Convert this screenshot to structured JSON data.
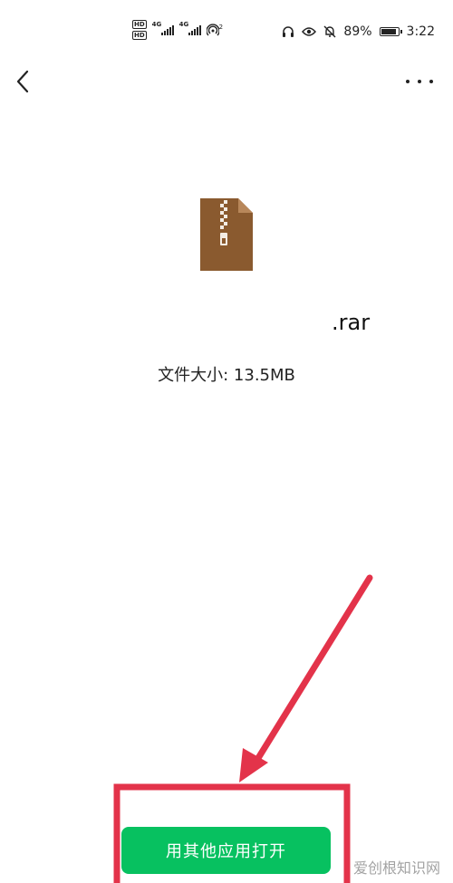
{
  "status_bar": {
    "hd1": "HD",
    "hd2": "HD",
    "signal1_gen": "4G",
    "signal2_gen": "4G",
    "hotspot_count": "2",
    "battery": "89%",
    "time": "3:22"
  },
  "file": {
    "name": ".rar",
    "size": "文件大小: 13.5MB"
  },
  "actions": {
    "open_with_label": "用其他应用打开"
  },
  "watermark": "爱创根知识网",
  "colors": {
    "primary_button": "#07c160",
    "annotation": "#e3334a",
    "file_icon": "#8a5a2f"
  }
}
